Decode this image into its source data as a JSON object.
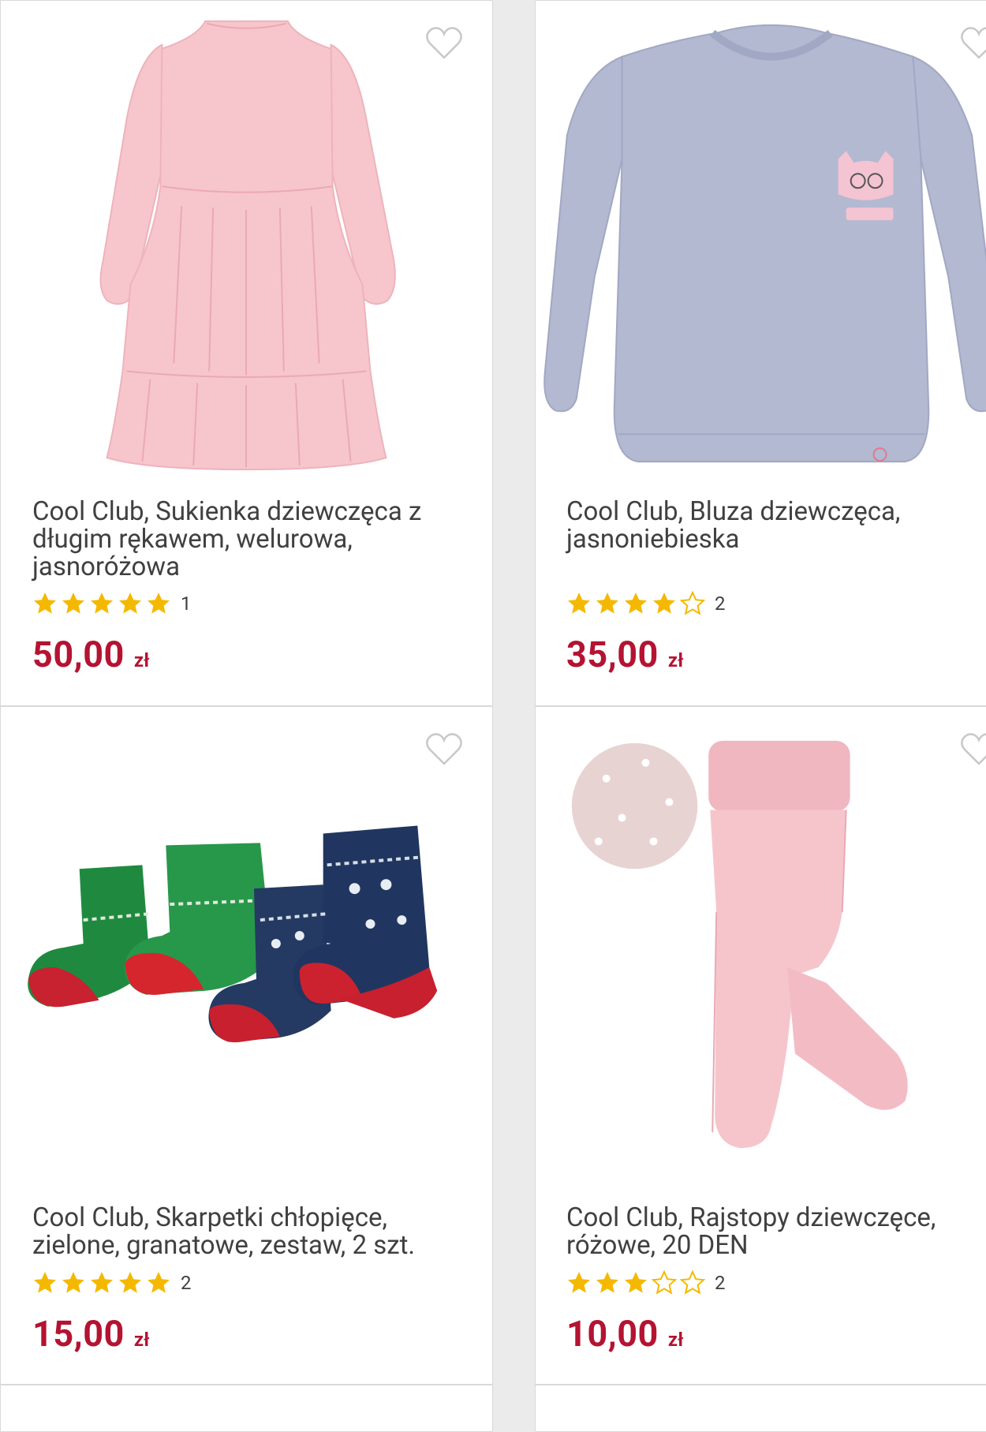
{
  "colors": {
    "price": "#b41332",
    "star_filled": "#f5b800",
    "star_empty_outline": "#f5b800",
    "page_bg": "#ebebeb",
    "card_bg": "#ffffff",
    "wishlist_outline": "#c8c8c8"
  },
  "products": [
    {
      "title": "Cool Club, Sukienka dziewczęca z długim rękawem, welurowa, jasnoróżowa",
      "rating": 5,
      "rating_count": "1",
      "price": "50,00",
      "currency": "zł",
      "image": "pink-velour-dress-image",
      "wishlist_icon": "heart-outline-icon"
    },
    {
      "title": "Cool Club, Bluza dziewczęca, jasnoniebieska",
      "rating": 4,
      "rating_count": "2",
      "price": "35,00",
      "currency": "zł",
      "image": "light-blue-sweatshirt-image",
      "wishlist_icon": "heart-outline-icon"
    },
    {
      "title": "Cool Club, Skarpetki chłopięce, zielone, granatowe, zestaw, 2 szt.",
      "rating": 5,
      "rating_count": "2",
      "price": "15,00",
      "currency": "zł",
      "image": "christmas-socks-set-image",
      "wishlist_icon": "heart-outline-icon"
    },
    {
      "title": "Cool Club, Rajstopy dziewczęce, różowe, 20 DEN",
      "rating": 3,
      "rating_count": "2",
      "price": "10,00",
      "currency": "zł",
      "image": "pink-tights-image",
      "wishlist_icon": "heart-outline-icon"
    }
  ]
}
